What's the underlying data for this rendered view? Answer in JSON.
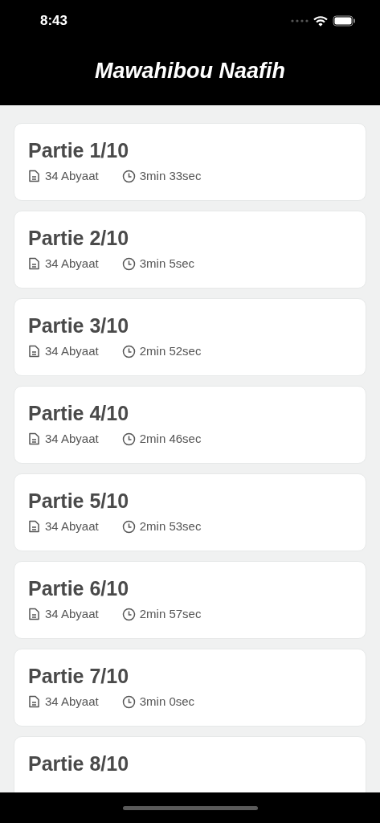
{
  "status_bar": {
    "time": "8:43"
  },
  "header": {
    "title": "Mawahibou Naafih"
  },
  "parts": [
    {
      "title": "Partie 1/10",
      "verses": "34 Abyaat",
      "duration": "3min 33sec"
    },
    {
      "title": "Partie 2/10",
      "verses": "34 Abyaat",
      "duration": "3min 5sec"
    },
    {
      "title": "Partie 3/10",
      "verses": "34 Abyaat",
      "duration": "2min 52sec"
    },
    {
      "title": "Partie 4/10",
      "verses": "34 Abyaat",
      "duration": "2min 46sec"
    },
    {
      "title": "Partie 5/10",
      "verses": "34 Abyaat",
      "duration": "2min 53sec"
    },
    {
      "title": "Partie 6/10",
      "verses": "34 Abyaat",
      "duration": "2min 57sec"
    },
    {
      "title": "Partie 7/10",
      "verses": "34 Abyaat",
      "duration": "3min 0sec"
    },
    {
      "title": "Partie 8/10"
    }
  ]
}
